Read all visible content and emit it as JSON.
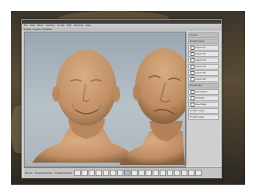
{
  "menubar": {
    "items": [
      "File",
      "Edit",
      "Mesh",
      "Surface",
      "Sculpt",
      "Edit",
      "Window",
      "Help"
    ]
  },
  "tabs": {
    "items": [
      "Sculpt",
      "Layers / Shapes"
    ]
  },
  "right_panel": {
    "header": "Layers",
    "section_label": "Sculpt Layer",
    "layers": [
      "Layer 01",
      "Layer 02",
      "Layer 03",
      "Layer 04",
      "Layer 05",
      "Layer 06"
    ],
    "subhead": "Properties",
    "options": [
      "Symmetry",
      "Smooth",
      "Use Mask"
    ],
    "extra_rows": [
      "Sculpt Layer",
      "Sculpt Layer"
    ]
  },
  "toolbar": {
    "labels": [
      "Brush",
      "Sculpting Tools",
      "Sculpting Tools"
    ]
  },
  "colors": {
    "skin": "#c79a6f",
    "skin_shadow": "#8f6a47",
    "viewport_top": "#9aa7b2"
  },
  "icons": [
    "sculpt-tool-icon"
  ]
}
